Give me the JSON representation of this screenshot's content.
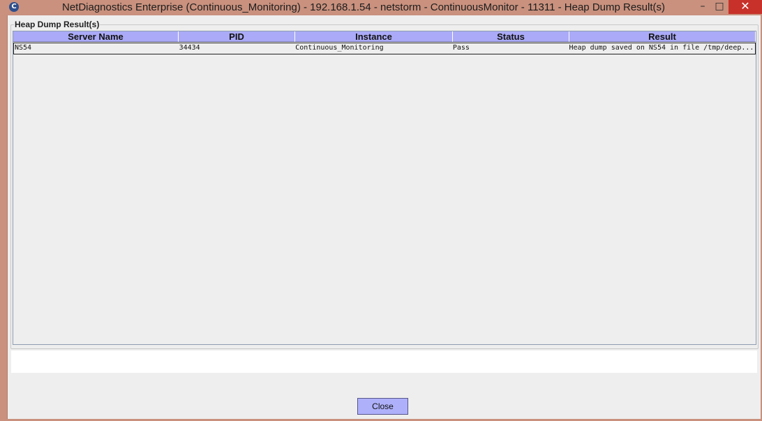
{
  "window": {
    "title": "NetDiagnostics Enterprise (Continuous_Monitoring) - 192.168.1.54 - netstorm - ContinuousMonitor - 11311 - Heap Dump Result(s)",
    "app_icon": "netdiagnostics-logo-icon",
    "minimize_glyph": "–",
    "maximize_glyph": "□",
    "close_glyph": "✕"
  },
  "panel": {
    "title": "Heap Dump Result(s)"
  },
  "table": {
    "columns": [
      "Server Name",
      "PID",
      "Instance",
      "Status",
      "Result"
    ],
    "rows": [
      {
        "server_name": "NS54",
        "pid": "34434",
        "instance": "Continuous_Monitoring",
        "status": "Pass",
        "result": "Heap dump saved on NS54 in file /tmp/deep..."
      }
    ]
  },
  "footer": {
    "close_label": "Close"
  },
  "colors": {
    "titlebar": "#c9917e",
    "header": "#aaaaf8",
    "close_button": "#aeb0fa",
    "window_close": "#c7312a"
  }
}
